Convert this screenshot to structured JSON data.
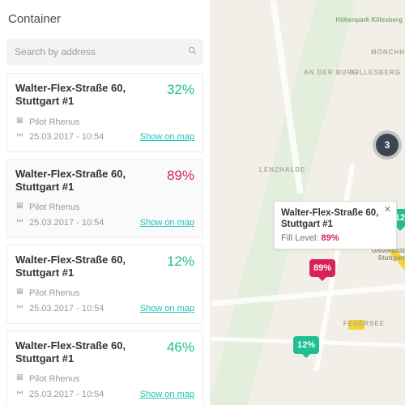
{
  "title": "Container",
  "search": {
    "placeholder": "Search by address"
  },
  "labels": {
    "show_on_map": "Show on map"
  },
  "colors": {
    "green": "#1fbf92",
    "red": "#d6245a",
    "teal": "#20c3b9",
    "cluster": "#3a4750"
  },
  "containers": [
    {
      "address": "Walter-Flex-Straße 60, Stuttgart #1",
      "percent": "32%",
      "level": "green",
      "provider": "Pilot Rhenus",
      "timestamp": "25.03.2017 - 10:54"
    },
    {
      "address": "Walter-Flex-Straße 60, Stuttgart #1",
      "percent": "89%",
      "level": "red",
      "provider": "Pilot Rhenus",
      "timestamp": "25.03.2017 - 10:54"
    },
    {
      "address": "Walter-Flex-Straße 60, Stuttgart #1",
      "percent": "12%",
      "level": "green",
      "provider": "Pilot Rhenus",
      "timestamp": "25.03.2017 - 10:54"
    },
    {
      "address": "Walter-Flex-Straße 60, Stuttgart #1",
      "percent": "46%",
      "level": "green",
      "provider": "Pilot Rhenus",
      "timestamp": "25.03.2017 - 10:54"
    }
  ],
  "map": {
    "neighborhoods": [
      "AN DER BURG",
      "KILLESBERG",
      "LENZHALDE",
      "FEUERSEE",
      "MÖNCHH"
    ],
    "hill_label": "Höhenpark Killesberg",
    "cluster": "3",
    "markers": [
      {
        "percent": "89%",
        "level": "red"
      },
      {
        "percent": "12%",
        "level": "green"
      },
      {
        "percent": "12",
        "level": "green"
      }
    ],
    "infobox": {
      "address": "Walter-Flex-Straße 60, Stuttgart #1",
      "fill_label": "Fill Level:",
      "fill_value": "89%",
      "fill_level": "red"
    },
    "uni_label": "Universität Stuttgart"
  }
}
